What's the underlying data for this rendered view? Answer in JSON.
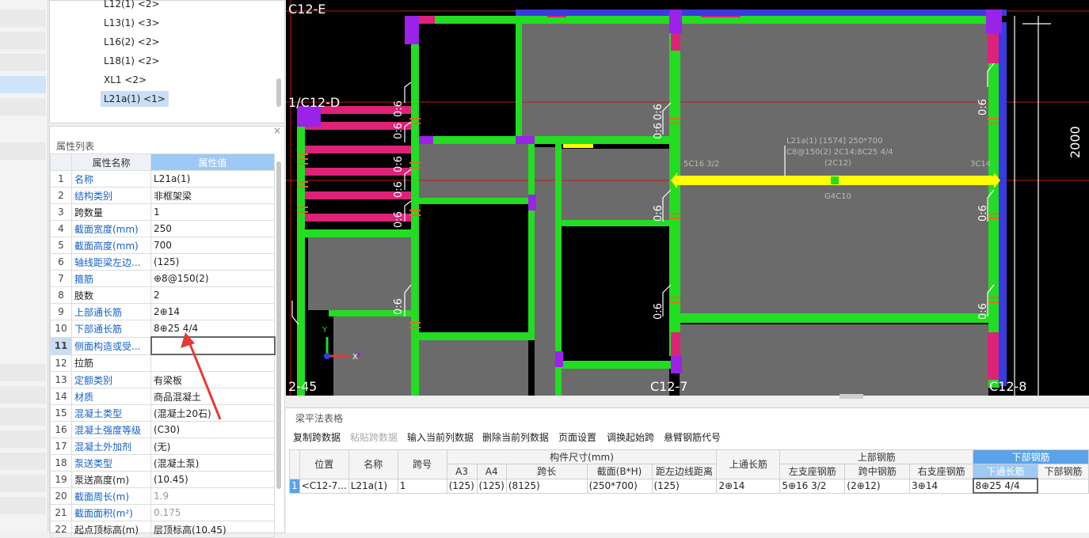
{
  "tree": {
    "items": [
      {
        "label": "L12(1) <2>"
      },
      {
        "label": "L13(1) <3>"
      },
      {
        "label": "L16(2) <2>"
      },
      {
        "label": "L18(1) <2>"
      },
      {
        "label": "XL1 <2>"
      },
      {
        "label": "L21a(1)   <1>"
      }
    ]
  },
  "props": {
    "title": "属性列表",
    "close": "×",
    "col_name": "属性名称",
    "col_value": "属性值",
    "rows": [
      {
        "n": "1",
        "name": "名称",
        "value": "L21a(1)"
      },
      {
        "n": "2",
        "name": "结构类别",
        "value": "非框架梁"
      },
      {
        "n": "3",
        "name": "跨数量",
        "value": "1"
      },
      {
        "n": "4",
        "name": "截面宽度(mm)",
        "value": "250"
      },
      {
        "n": "5",
        "name": "截面高度(mm)",
        "value": "700"
      },
      {
        "n": "6",
        "name": "轴线距梁左边...",
        "value": "(125)"
      },
      {
        "n": "7",
        "name": "箍筋",
        "value": "⊕8@150(2)"
      },
      {
        "n": "8",
        "name": "肢数",
        "value": "2"
      },
      {
        "n": "9",
        "name": "上部通长筋",
        "value": "2⊕14"
      },
      {
        "n": "10",
        "name": "下部通长筋",
        "value": "8⊕25 4/4"
      },
      {
        "n": "11",
        "name": "侧面构造或受...",
        "value": ""
      },
      {
        "n": "12",
        "name": "拉筋",
        "value": ""
      },
      {
        "n": "13",
        "name": "定额类别",
        "value": "有梁板"
      },
      {
        "n": "14",
        "name": "材质",
        "value": "商品混凝土"
      },
      {
        "n": "15",
        "name": "混凝土类型",
        "value": "(混凝土20石)"
      },
      {
        "n": "16",
        "name": "混凝土强度等级",
        "value": "(C30)"
      },
      {
        "n": "17",
        "name": "混凝土外加剂",
        "value": "(无)"
      },
      {
        "n": "18",
        "name": "泵送类型",
        "value": "(混凝土泵)"
      },
      {
        "n": "19",
        "name": "泵送高度(m)",
        "value": "(10.45)"
      },
      {
        "n": "20",
        "name": "截面周长(m)",
        "value": "1.9"
      },
      {
        "n": "21",
        "name": "截面面积(m²)",
        "value": "0.175"
      },
      {
        "n": "22",
        "name": "起点顶标高(m)",
        "value": "层顶标高(10.45)"
      }
    ]
  },
  "cad": {
    "grid_labels": {
      "c12e": "C12-E",
      "c12d": "1/C12-D",
      "c125": "2-45",
      "c127": "C12-7",
      "c128": "C12-8"
    },
    "dim_2000": "2000",
    "beam_label_1": "L21a(1)   [1574] 250*700",
    "beam_label_2": "C8@150(2) 2C14;8C25 4/4",
    "beam_label_3": "(2C12)",
    "left_support": "5C16 3/2",
    "right_support": "3C14",
    "bottom_label": "G4C10",
    "stirrup_tag": "0:6",
    "axis_y": "Y",
    "axis_x": "X"
  },
  "bottom": {
    "title": "梁平法表格",
    "toolbar": [
      "复制跨数据",
      "粘贴跨数据",
      "输入当前列数据",
      "删除当前列数据",
      "页面设置",
      "调换起始跨",
      "悬臂钢筋代号"
    ],
    "headers": {
      "position": "位置",
      "name": "名称",
      "span": "跨号",
      "size": "构件尺寸(mm)",
      "a3": "A3",
      "a4": "A4",
      "span_len": "跨长",
      "section": "截面(B*H)",
      "offset": "距左边线距离",
      "top_through": "上通长筋",
      "top_rebar": "上部钢筋",
      "left_support": "左支座钢筋",
      "mid": "跨中钢筋",
      "right_support": "右支座钢筋",
      "bottom_rebar": "下部钢筋",
      "bottom_through": "下通长筋",
      "bottom_rebar2": "下部钢筋"
    },
    "row": {
      "idx": "1",
      "position": "<C12-7...",
      "name": "L21a(1)",
      "span": "1",
      "a3": "(125)",
      "a4": "(125)",
      "span_len": "(8125)",
      "section": "(250*700)",
      "offset": "(125)",
      "top_through": "2⊕14",
      "left_support": "5⊕16 3/2",
      "mid": "(2⊕12)",
      "right_support": "3⊕14",
      "bottom_through": "8⊕25 4/4",
      "bottom2": ""
    }
  },
  "colors": {
    "accent": "#9cc9f5",
    "beam_green": "#22dd22",
    "beam_magenta": "#dd2277",
    "beam_yellow": "#ffff00",
    "arrow_red": "#e53935"
  }
}
